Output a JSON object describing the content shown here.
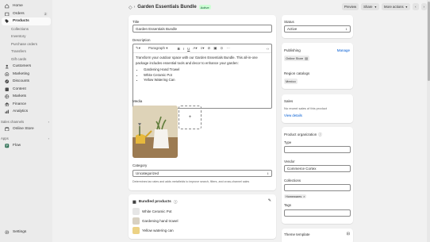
{
  "sidebar": {
    "items": [
      {
        "label": "Home"
      },
      {
        "label": "Orders",
        "badge": "2"
      },
      {
        "label": "Products"
      },
      {
        "label": "Customers"
      },
      {
        "label": "Marketing"
      },
      {
        "label": "Discounts"
      },
      {
        "label": "Content"
      },
      {
        "label": "Markets"
      },
      {
        "label": "Finance"
      },
      {
        "label": "Analytics"
      }
    ],
    "sub_items": [
      "Collections",
      "Inventory",
      "Purchase orders",
      "Transfers",
      "Gift cards"
    ],
    "sales_channels_label": "Sales channels",
    "online_store_label": "Online Store",
    "apps_label": "Apps",
    "flow_label": "Flow",
    "settings_label": "Settings"
  },
  "header": {
    "title": "Garden Essentials Bundle",
    "status": "Active",
    "preview": "Preview",
    "share": "Share",
    "more_actions": "More actions"
  },
  "product": {
    "title_label": "Title",
    "title_value": "Garden Essentials Bundle",
    "description_label": "Description",
    "paragraph_label": "Paragraph",
    "description_text": "Transform your outdoor space with our Garden Essentials Bundle. This all-in-one package includes essential tools and decor to enhance your garden:",
    "bullets": [
      "Gardening Hand Trowel",
      "White Ceramic Pot",
      "Yellow Watering Can"
    ],
    "media_label": "Media",
    "category_label": "Category",
    "category_value": "Uncategorized",
    "category_help": "Determines tax rates and adds metafields to improve search, filters, and cross-channel sales"
  },
  "bundled": {
    "title": "Bundled products",
    "items": [
      "White Ceramic Pot",
      "Gardening hand trowel",
      "Yellow watering can"
    ]
  },
  "status_card": {
    "label": "Status",
    "value": "Active"
  },
  "publishing": {
    "label": "Publishing",
    "manage": "Manage",
    "online_store": "Online Store",
    "region_label": "Region catalogs",
    "region_value": "Mexico"
  },
  "sales": {
    "label": "Sales",
    "text": "No recent sales of this product",
    "link": "View details"
  },
  "organization": {
    "label": "Product organization",
    "type_label": "Type",
    "vendor_label": "Vendor",
    "vendor_value": "Commerce Cortex",
    "collections_label": "Collections",
    "collection_tag": "Homewares",
    "tags_label": "Tags"
  },
  "theme": {
    "label": "Theme template"
  },
  "colors": {
    "accent": "#005bd3",
    "active_pill": "#cdfed4",
    "sidebar": "#ebebeb",
    "page": "#f1f1f1"
  }
}
